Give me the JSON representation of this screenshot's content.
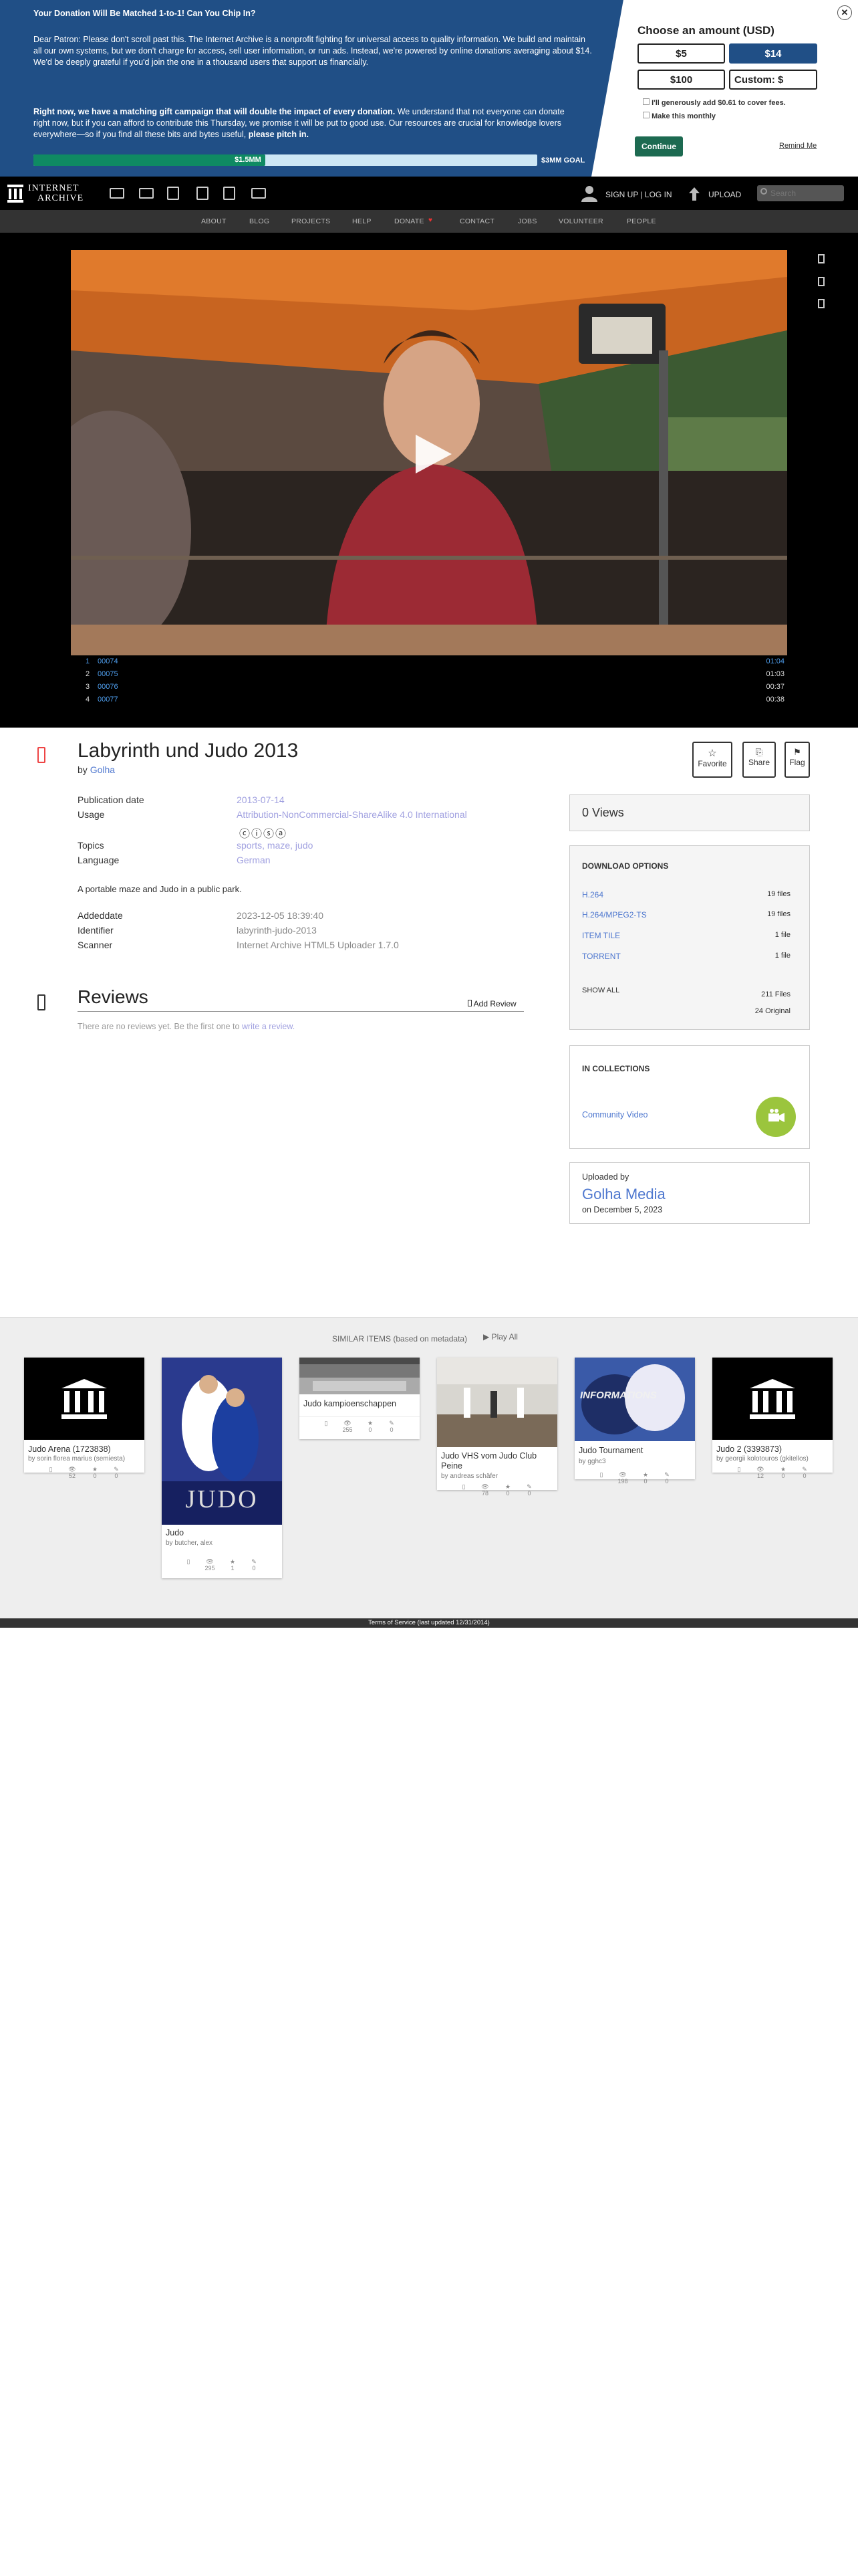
{
  "banner": {
    "title": "Your Donation Will Be Matched 1-to-1! Can You Chip In?",
    "body": "Dear Patron: Please don't scroll past this. The Internet Archive is a nonprofit fighting for universal access to quality information. We build and maintain all our own systems, but we don't charge for access, sell user information, or run ads. Instead, we're powered by online donations averaging about $14. We'd be deeply grateful if you'd join the one in a thousand users that support us financially.",
    "body2_bold": "Right now, we have a matching gift campaign that will double the impact of every donation.",
    "body2_rest": " We understand that not everyone can donate right now, but if you can afford to contribute this Thursday, we promise it will be put to good use. Our resources are crucial for knowledge lovers everywhere—so if you find all these bits and bytes useful,",
    "body2_end": "please pitch in.",
    "progress_label": "$1.5MM",
    "progress_fraction": 0.46,
    "goal_label": "$3MM GOAL",
    "choose_title": "Choose an amount (USD)",
    "amounts": [
      "$5",
      "$14",
      "$100",
      "Custom: $"
    ],
    "cover_fees": "I'll generously add $0.61 to cover fees.",
    "monthly": "Make this monthly",
    "continue": "Continue",
    "remind": "Remind Me",
    "close": "✕"
  },
  "topnav": {
    "logo_line1": "INTERNET",
    "logo_line2": "ARCHIVE",
    "signup": "SIGN UP | LOG IN",
    "upload": "UPLOAD",
    "search_placeholder": "Search"
  },
  "subnav": [
    "ABOUT",
    "BLOG",
    "PROJECTS",
    "HELP",
    "DONATE",
    "CONTACT",
    "JOBS",
    "VOLUNTEER",
    "PEOPLE"
  ],
  "playlist": [
    {
      "num": "1",
      "name": "00074",
      "time": "01:04"
    },
    {
      "num": "2",
      "name": "00075",
      "time": "01:03"
    },
    {
      "num": "3",
      "name": "00076",
      "time": "00:37"
    },
    {
      "num": "4",
      "name": "00077",
      "time": "00:38"
    }
  ],
  "item": {
    "title": "Labyrinth und Judo 2013",
    "by_prefix": "by",
    "creator": "Golha",
    "meta": [
      {
        "label": "Publication date",
        "value": "2013-07-14"
      },
      {
        "label": "Usage",
        "value": "Attribution-NonCommercial-ShareAlike 4.0 International"
      },
      {
        "label": "Topics",
        "value": "sports, maze, judo"
      },
      {
        "label": "Language",
        "value": "German"
      }
    ],
    "description": "A portable maze and Judo in a public park.",
    "meta2": [
      {
        "label": "Addeddate",
        "value": "2023-12-05 18:39:40"
      },
      {
        "label": "Identifier",
        "value": "labyrinth-judo-2013"
      },
      {
        "label": "Scanner",
        "value": "Internet Archive HTML5 Uploader 1.7.0"
      }
    ]
  },
  "actions": {
    "favorite": "Favorite",
    "share": "Share",
    "flag": "Flag"
  },
  "reviews": {
    "title": "Reviews",
    "add": "Add Review",
    "empty_text": "There are no reviews yet. Be the first one to",
    "empty_link": "write a review."
  },
  "views": "0 Views",
  "downloads": {
    "title": "DOWNLOAD OPTIONS",
    "rows": [
      {
        "name": "H.264",
        "count": "19 files"
      },
      {
        "name": "H.264/MPEG2-TS",
        "count": "19 files"
      },
      {
        "name": "ITEM TILE",
        "count": "1 file"
      },
      {
        "name": "TORRENT",
        "count": "1 file"
      }
    ],
    "show_all": "SHOW ALL",
    "total_files": "211 Files",
    "original": "24 Original"
  },
  "collections": {
    "title": "IN COLLECTIONS",
    "name": "Community Video"
  },
  "uploader": {
    "label": "Uploaded by",
    "name": "Golha Media",
    "date": "on December 5, 2023"
  },
  "similar": {
    "title": "SIMILAR ITEMS (based on metadata)",
    "play_all": "Play All",
    "items": [
      {
        "title": "Judo Arena (1723838)",
        "by": "by sorin florea marius (semiesta)",
        "views": "52",
        "favs": "0",
        "reviews": "0"
      },
      {
        "title": "Judo",
        "by": "by butcher, alex",
        "views": "295",
        "favs": "1",
        "reviews": "0"
      },
      {
        "title": "Judo kampioenschappen",
        "by": "",
        "views": "255",
        "favs": "0",
        "reviews": "0"
      },
      {
        "title": "Judo VHS vom Judo Club Peine",
        "by": "by andreas schäfer",
        "views": "78",
        "favs": "0",
        "reviews": "0"
      },
      {
        "title": "Judo Tournament",
        "by": "by gghc3",
        "views": "198",
        "favs": "0",
        "reviews": "0"
      },
      {
        "title": "Judo 2 (3393873)",
        "by": "by georgii kolotouros (gkitellos)",
        "views": "12",
        "favs": "0",
        "reviews": "0"
      }
    ],
    "judo_cover_text": "JUDO",
    "tournament_text": "INFORMATIONS"
  },
  "footer": "Terms of Service (last updated 12/31/2014)"
}
